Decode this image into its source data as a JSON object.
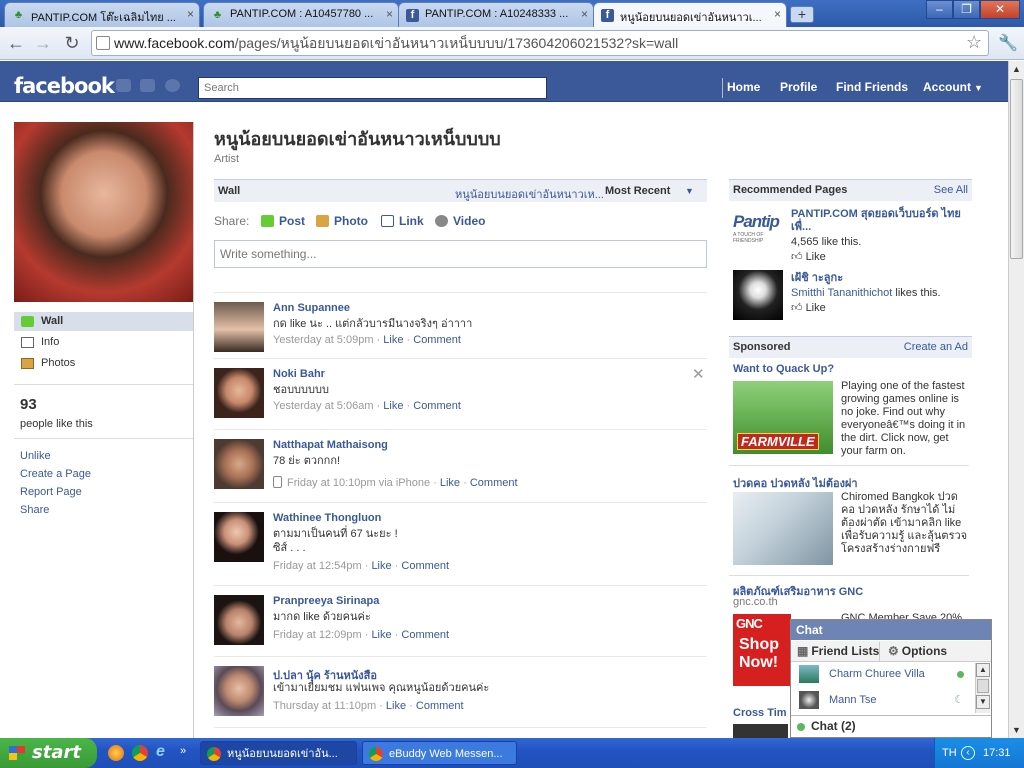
{
  "browser": {
    "tabs": [
      {
        "title": "PANTIP.COM โต๊ะเฉลิมไทย ...",
        "icon": "cactus-icon",
        "active": false
      },
      {
        "title": "PANTIP.COM : A10457780 ...",
        "icon": "cactus-icon",
        "active": false
      },
      {
        "title": "PANTIP.COM : A10248333 ...",
        "icon": "facebook-icon",
        "active": false
      },
      {
        "title": "หนูน้อยบนยอดเข่าอันหนาวเ...",
        "icon": "facebook-icon",
        "active": true
      }
    ],
    "url_host": "www.facebook.com",
    "url_path": "/pages/หนูน้อยบนยอดเข่าอันหนาวเหน็บบบบ/173604206021532?sk=wall"
  },
  "fb_header": {
    "logo": "facebook",
    "search_placeholder": "Search",
    "nav": [
      "Home",
      "Profile",
      "Find Friends",
      "Account"
    ]
  },
  "left": {
    "nav": [
      {
        "label": "Wall",
        "icon": "wall-icon",
        "active": true
      },
      {
        "label": "Info",
        "icon": "info-icon",
        "active": false
      },
      {
        "label": "Photos",
        "icon": "photos-icon",
        "active": false
      }
    ],
    "like_count": "93",
    "like_label": "people like this",
    "links": [
      "Unlike",
      "Create a Page",
      "Report Page",
      "Share"
    ]
  },
  "main": {
    "title": "หนูน้อยบนยอดเข่าอันหนาวเหน็บบบบ",
    "category": "Artist",
    "wall_label": "Wall",
    "filter_page": "หนูน้อยบนยอดเข่าอันหนาวเห...",
    "filter_sort": "Most Recent",
    "share_label": "Share:",
    "share_buttons": [
      "Post",
      "Photo",
      "Link",
      "Video"
    ],
    "composer_placeholder": "Write something...",
    "stories": [
      {
        "name": "Ann Supannee",
        "text": "กด like นะ .. แต่กลัวบารมีนางจริงๆ อ่าาาา",
        "time": "Yesterday at 5:09pm",
        "via": "",
        "like": "Like",
        "comment": "Comment"
      },
      {
        "name": "Noki Bahr",
        "text": "ชอบบบบบบ",
        "time": "Yesterday at 5:06am",
        "via": "",
        "like": "Like",
        "comment": "Comment"
      },
      {
        "name": "Natthapat Mathaisong",
        "text": "78 ย่ะ ตวกกก!",
        "time": "Friday at 10:10pm via iPhone",
        "via": "iphone",
        "like": "Like",
        "comment": "Comment"
      },
      {
        "name": "Wathinee Thongluon",
        "text": "ตามมาเป็นคนที่ 67 นะยะ !\nซิส์ . . .",
        "time": "Friday at 12:54pm",
        "via": "",
        "like": "Like",
        "comment": "Comment"
      },
      {
        "name": "Pranpreeya Sirinapa",
        "text": "มากด like ด้วยคนค่ะ",
        "time": "Friday at 12:09pm",
        "via": "",
        "like": "Like",
        "comment": "Comment"
      },
      {
        "name": "ป.ปลา นุ้ค ร้านหนังสือ",
        "text": "เข้ามาเยี่ยมชม แฟนเพจ คุณหนูน้อยด้วยคนค่ะ",
        "time": "Thursday at 11:10pm",
        "via": "",
        "like": "Like",
        "comment": "Comment"
      }
    ]
  },
  "right": {
    "recommended_title": "Recommended Pages",
    "see_all": "See All",
    "recommended": [
      {
        "name": "PANTIP.COM สุดยอดเว็บบอร์ด ไทย เพื่...",
        "stat": "4,565 like this.",
        "like": "Like",
        "logo": "Pantip",
        "logo_sub": "A TOUCH OF FRIENDSHIP"
      },
      {
        "name": "เฝ้ชิ าะลูกะ",
        "stat_name": "Smitthi Tananithichot",
        "stat": "likes this.",
        "like": "Like"
      }
    ],
    "sponsored_title": "Sponsored",
    "create_ad": "Create an Ad",
    "ads": [
      {
        "title": "Want to Quack Up?",
        "text": "Playing one of the fastest growing games online is no joke. Find out why everyoneâ€™s doing it in the dirt. Click now, get your farm on.",
        "image_text": "FARMVILLE"
      },
      {
        "title": "ปวดคอ ปวดหลัง ไม่ต้องผ่า",
        "text": "Chiromed Bangkok ปวดคอ ปวดหลัง รักษาได้ ไม่ต้องผ่าตัด เข้ามาคลิก like เพื่อรับความรู้ และลุ้นตรวจโครงสร้างร่างกายฟรี"
      },
      {
        "title": "ผลิตภัณฑ์เสริมอาหาร GNC",
        "domain": "gnc.co.th",
        "text": "GNC Member Save 20%",
        "image_text": "Shop Now!"
      },
      {
        "title": "Cross Tim"
      }
    ]
  },
  "chat": {
    "title": "Chat",
    "friend_lists": "Friend Lists",
    "options": "Options",
    "friends": [
      {
        "name": "Charm Churee Villa",
        "status": "online"
      },
      {
        "name": "Mann Tse",
        "status": "idle"
      }
    ],
    "bar_label": "Chat (2)"
  },
  "taskbar": {
    "start": "start",
    "tasks": [
      "หนูน้อยบนยอดเข่าอัน...",
      "eBuddy Web Messen..."
    ],
    "lang": "TH",
    "clock": "17:31"
  },
  "colors": {
    "fb_blue": "#3b5998",
    "header_bg": "#eceff5",
    "chat_head": "#6d84b4"
  }
}
